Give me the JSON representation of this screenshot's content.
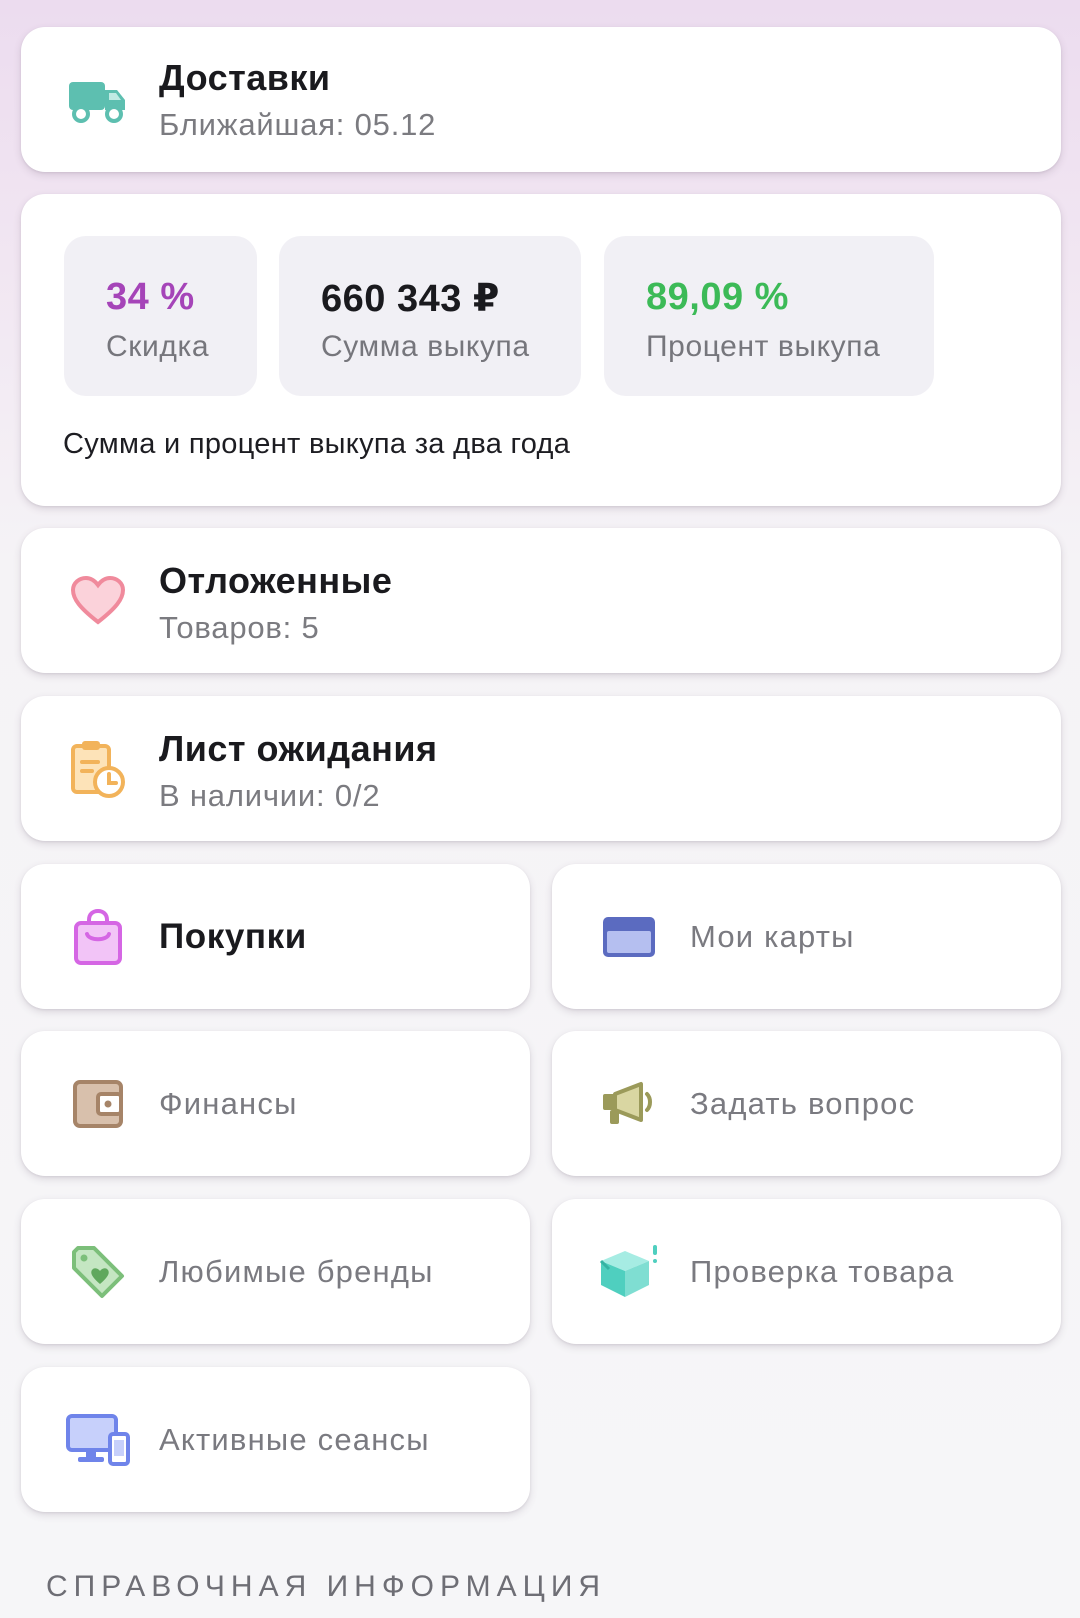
{
  "deliveries": {
    "title": "Доставки",
    "subtitle": "Ближайшая: 05.12",
    "icon": "truck-icon"
  },
  "stats": {
    "discount": {
      "value": "34 %",
      "label": "Скидка",
      "color": "#a544b8"
    },
    "purchase_sum": {
      "value": "660 343 ₽",
      "label": "Сумма выкупа",
      "color": "#1a1a1e"
    },
    "purchase_percent": {
      "value": "89,09 %",
      "label": "Процент выкупа",
      "color": "#3cba57"
    },
    "note": "Сумма и процент выкупа за два года"
  },
  "favorites": {
    "title": "Отложенные",
    "subtitle": "Товаров: 5",
    "icon": "heart-icon"
  },
  "waitlist": {
    "title": "Лист ожидания",
    "subtitle": "В наличии: 0/2",
    "icon": "clipboard-clock-icon"
  },
  "tiles": {
    "purchases": "Покупки",
    "my_cards": "Мои карты",
    "finances": "Финансы",
    "ask_question": "Задать вопрос",
    "favorite_brands": "Любимые бренды",
    "product_check": "Проверка товара",
    "active_sessions": "Активные сеансы"
  },
  "section_header": "СПРАВОЧНАЯ ИНФОРМАЦИЯ",
  "colors": {
    "truck": "#5dbfb0",
    "heart": "#f08a9c",
    "clipboard": "#f2b35a",
    "bag": "#d566e4",
    "card": "#5b6bc0",
    "wallet": "#a68468",
    "megaphone": "#9b9a5a",
    "tag": "#7cbf7a",
    "box": "#4fcfbf",
    "devices": "#6f84ea"
  }
}
